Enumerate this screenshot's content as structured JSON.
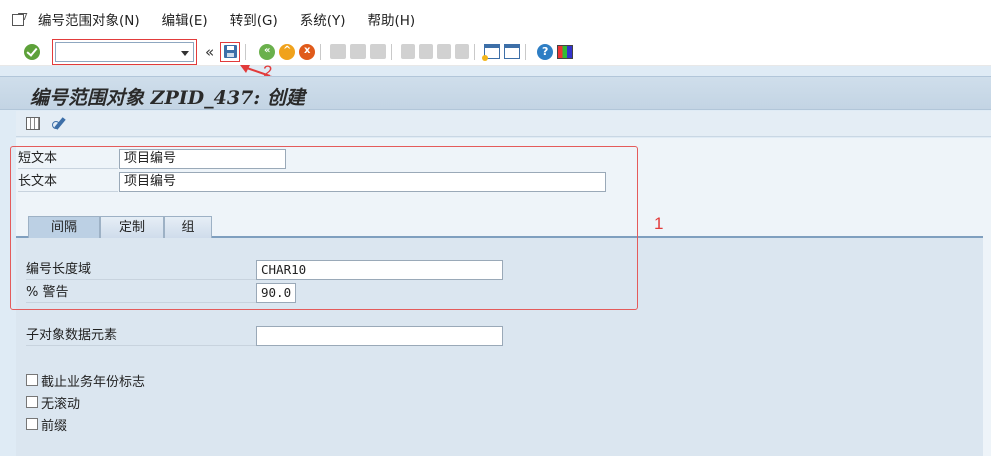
{
  "menu": {
    "items": [
      "编号范围对象(N)",
      "编辑(E)",
      "转到(G)",
      "系统(Y)",
      "帮助(H)"
    ]
  },
  "toolbar": {
    "command_field_value": "",
    "chevron": "«",
    "help_glyph": "?"
  },
  "title": "编号范围对象 ZPID_437: 创建",
  "form": {
    "short_text_label": "短文本",
    "short_text_value": "项目编号",
    "long_text_label": "长文本",
    "long_text_value": "项目编号",
    "tabs": [
      "间隔",
      "定制",
      "组"
    ],
    "active_tab": "间隔",
    "domain_label": "编号长度域",
    "domain_value": "CHAR10",
    "warning_label": "% 警告",
    "warning_value": "90.0",
    "subobject_label": "子对象数据元素",
    "subobject_value": "",
    "checkboxes": [
      {
        "label": "截止业务年份标志",
        "checked": false
      },
      {
        "label": "无滚动",
        "checked": false
      },
      {
        "label": "前缀",
        "checked": false
      }
    ]
  },
  "annotations": {
    "box1_number": "1",
    "save_number": "2",
    "color": "#e23b3b"
  }
}
